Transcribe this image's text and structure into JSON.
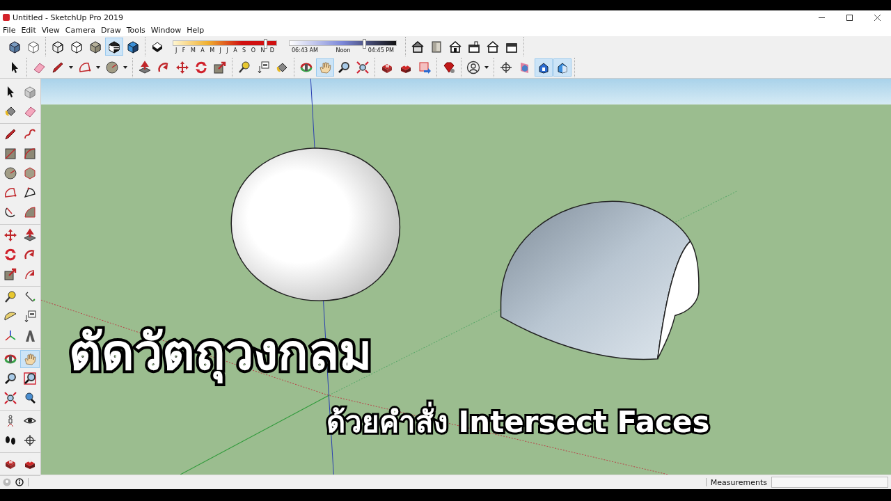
{
  "window": {
    "title": "Untitled - SketchUp Pro 2019"
  },
  "menu": [
    {
      "label": "File"
    },
    {
      "label": "Edit"
    },
    {
      "label": "View"
    },
    {
      "label": "Camera"
    },
    {
      "label": "Draw"
    },
    {
      "label": "Tools"
    },
    {
      "label": "Window"
    },
    {
      "label": "Help"
    }
  ],
  "toolbar_rows": [
    [
      {
        "items": [
          {
            "kind": "cube-xray",
            "selected": false
          },
          {
            "kind": "cube-back",
            "selected": false
          }
        ]
      },
      {
        "items": [
          {
            "kind": "cube-wire",
            "selected": false
          },
          {
            "kind": "cube-white",
            "selected": false
          },
          {
            "kind": "cube-grey",
            "selected": false
          },
          {
            "kind": "cube-striped",
            "selected": true
          },
          {
            "kind": "cube-blue",
            "selected": false
          }
        ]
      },
      {
        "items": [
          {
            "kind": "shadow",
            "selected": false
          },
          {
            "kind": "month-slider",
            "level": 0.89,
            "labels": [
              "J",
              "F",
              "M",
              "A",
              "M",
              "J",
              "J",
              "A",
              "S",
              "O",
              "N",
              "D"
            ]
          },
          {
            "kind": "time-slider",
            "level": 0.7,
            "labels": [
              "06:43 AM",
              "Noon",
              "04:45 PM"
            ]
          }
        ]
      },
      {
        "items": [
          {
            "kind": "house-grey",
            "selected": false
          },
          {
            "kind": "door",
            "selected": false
          },
          {
            "kind": "house",
            "selected": false
          },
          {
            "kind": "house-top",
            "selected": false
          },
          {
            "kind": "house-outline",
            "selected": false
          },
          {
            "kind": "house-flat",
            "selected": false
          }
        ]
      }
    ],
    [
      {
        "items": [
          {
            "kind": "pointer",
            "selected": false
          }
        ]
      },
      {
        "items": [
          {
            "kind": "eraser",
            "selected": false
          },
          {
            "kind": "pencil",
            "selected": false,
            "dropdown": true
          },
          {
            "kind": "arc",
            "selected": false,
            "dropdown": true
          },
          {
            "kind": "circle",
            "selected": false,
            "dropdown": true
          }
        ]
      },
      {
        "items": [
          {
            "kind": "pushpull",
            "selected": false
          },
          {
            "kind": "followme",
            "selected": false
          },
          {
            "kind": "move",
            "selected": false
          },
          {
            "kind": "rotate",
            "selected": false
          },
          {
            "kind": "scale",
            "selected": false
          }
        ]
      },
      {
        "items": [
          {
            "kind": "tape",
            "selected": false
          },
          {
            "kind": "text",
            "selected": false
          },
          {
            "kind": "paint",
            "selected": false
          }
        ]
      },
      {
        "items": [
          {
            "kind": "orbit",
            "selected": false
          },
          {
            "kind": "pan",
            "selected": true
          },
          {
            "kind": "zoom",
            "selected": false
          },
          {
            "kind": "extents",
            "selected": false
          }
        ]
      },
      {
        "items": [
          {
            "kind": "warehouse",
            "selected": false
          },
          {
            "kind": "warehouse2",
            "selected": false
          },
          {
            "kind": "share",
            "selected": false
          }
        ]
      },
      {
        "items": [
          {
            "kind": "gem",
            "selected": false
          }
        ]
      },
      {
        "items": [
          {
            "kind": "person",
            "selected": false,
            "dropdown": true
          }
        ]
      },
      {
        "items": [
          {
            "kind": "target",
            "selected": false
          },
          {
            "kind": "section",
            "selected": false
          },
          {
            "kind": "view-a",
            "selected": true
          },
          {
            "kind": "view-b",
            "selected": true
          }
        ]
      }
    ]
  ],
  "side_toolbar": [
    {
      "items": [
        {
          "kind": "pointer",
          "selected": false
        },
        {
          "kind": "component",
          "selected": false
        },
        {
          "kind": "paint",
          "selected": false
        },
        {
          "kind": "eraser",
          "selected": false
        }
      ]
    },
    {
      "items": [
        {
          "kind": "pencil",
          "selected": false
        },
        {
          "kind": "freehand",
          "selected": false
        },
        {
          "kind": "rect",
          "selected": false
        },
        {
          "kind": "rect-rot",
          "selected": false
        },
        {
          "kind": "circle",
          "selected": false
        },
        {
          "kind": "polygon",
          "selected": false
        },
        {
          "kind": "arc",
          "selected": false
        },
        {
          "kind": "arc2",
          "selected": false
        },
        {
          "kind": "arc3",
          "selected": false
        },
        {
          "kind": "pie",
          "selected": false
        }
      ]
    },
    {
      "items": [
        {
          "kind": "move",
          "selected": false
        },
        {
          "kind": "pushpull",
          "selected": false
        },
        {
          "kind": "rotate",
          "selected": false
        },
        {
          "kind": "followme",
          "selected": false
        },
        {
          "kind": "scale",
          "selected": false
        },
        {
          "kind": "offset",
          "selected": false
        }
      ]
    },
    {
      "items": [
        {
          "kind": "tape",
          "selected": false
        },
        {
          "kind": "dimension",
          "selected": false
        },
        {
          "kind": "protractor",
          "selected": false
        },
        {
          "kind": "text",
          "selected": false
        },
        {
          "kind": "axes",
          "selected": false
        },
        {
          "kind": "text3d",
          "selected": false
        }
      ]
    },
    {
      "items": [
        {
          "kind": "orbit",
          "selected": false
        },
        {
          "kind": "pan",
          "selected": true
        },
        {
          "kind": "zoom",
          "selected": false
        },
        {
          "kind": "zoom-window",
          "selected": false
        },
        {
          "kind": "extents",
          "selected": false
        },
        {
          "kind": "previous",
          "selected": false
        }
      ]
    },
    {
      "items": [
        {
          "kind": "walk",
          "selected": false
        },
        {
          "kind": "eye",
          "selected": false
        },
        {
          "kind": "footprints",
          "selected": false
        },
        {
          "kind": "target",
          "selected": false
        }
      ]
    },
    {
      "items": [
        {
          "kind": "warehouse",
          "selected": false
        },
        {
          "kind": "warehouse2",
          "selected": false
        }
      ]
    }
  ],
  "overlay": {
    "title": "ตัดวัตถุวงกลม",
    "subtitle": "ด้วยคำสั่ง Intersect Faces"
  },
  "status_bar": {
    "measurements_label": "Measurements"
  }
}
